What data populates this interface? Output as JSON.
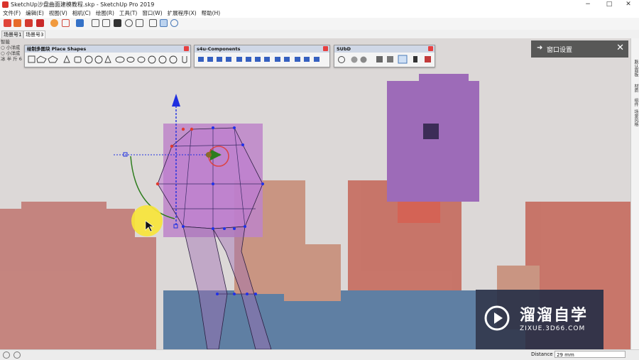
{
  "window": {
    "title": "SketchUp沙盘曲面建模教程.skp - SketchUp Pro 2019",
    "controls": [
      "−",
      "□",
      "✕"
    ]
  },
  "menu": [
    "文件(F)",
    "编辑(E)",
    "视图(V)",
    "相机(C)",
    "绘图(R)",
    "工具(T)",
    "窗口(W)",
    "扩展程序(X)",
    "帮助(H)"
  ],
  "scene_tabs": [
    "场景号1",
    "场景号3"
  ],
  "left_panel": [
    "智能",
    "○ 小洋成",
    "○ 小洋成",
    "冰 半 斤 6"
  ],
  "palettes": {
    "shapes": {
      "title": "绘制多图块 Place Shapes"
    },
    "components": {
      "title": "s4u-Components"
    },
    "subd": {
      "title": "SUbD"
    }
  },
  "tray": {
    "title": "窗口设置"
  },
  "right_strip": [
    "默认面板",
    "材质",
    "组件",
    "场景风格"
  ],
  "status": {
    "label": "Distance",
    "value": "29 mm"
  },
  "watermark": {
    "title": "溜溜自学",
    "url": "ZIXUE.3D66.COM"
  },
  "colors": {
    "accent_red": "#e03a2f",
    "axis_blue": "#1f2fe0",
    "axis_green": "#2e7d1e",
    "highlight_yellow": "#f7e53a",
    "mesh_purple": "#a55bc5"
  }
}
